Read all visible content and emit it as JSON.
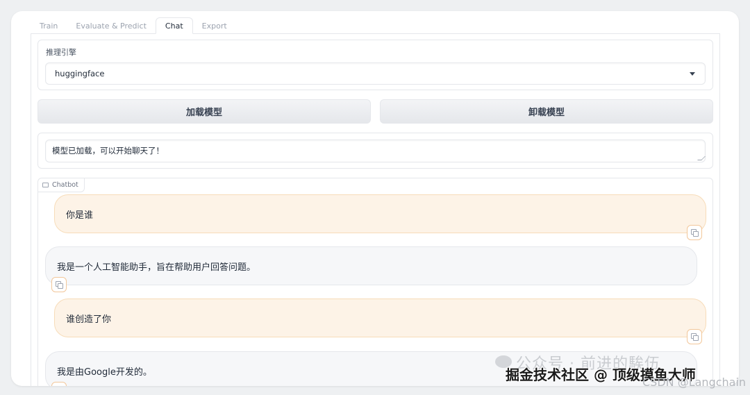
{
  "tabs": [
    {
      "label": "Train",
      "active": false
    },
    {
      "label": "Evaluate & Predict",
      "active": false
    },
    {
      "label": "Chat",
      "active": true
    },
    {
      "label": "Export",
      "active": false
    }
  ],
  "engine": {
    "label": "推理引擎",
    "selected": "huggingface"
  },
  "buttons": {
    "load": "加载模型",
    "unload": "卸载模型"
  },
  "status": {
    "value": "模型已加载，可以开始聊天了！"
  },
  "chatbot": {
    "label": "Chatbot",
    "messages": [
      {
        "role": "user",
        "text": "你是谁"
      },
      {
        "role": "assistant",
        "text": "我是一个人工智能助手，旨在帮助用户回答问题。"
      },
      {
        "role": "user",
        "text": "谁创造了你"
      },
      {
        "role": "assistant",
        "text": "我是由Google开发的。"
      }
    ]
  },
  "watermarks": {
    "wechat": "公众号 · 前进的騃伍",
    "juejin": "掘金技术社区 @ 顶级摸鱼大师",
    "csdn": "CSDN @Langchain"
  },
  "colors": {
    "user_bubble": "#fdf3e7",
    "user_border": "#f7dcb9",
    "bot_bubble": "#f6f7f9",
    "button_bg": "#e5e7eb"
  }
}
